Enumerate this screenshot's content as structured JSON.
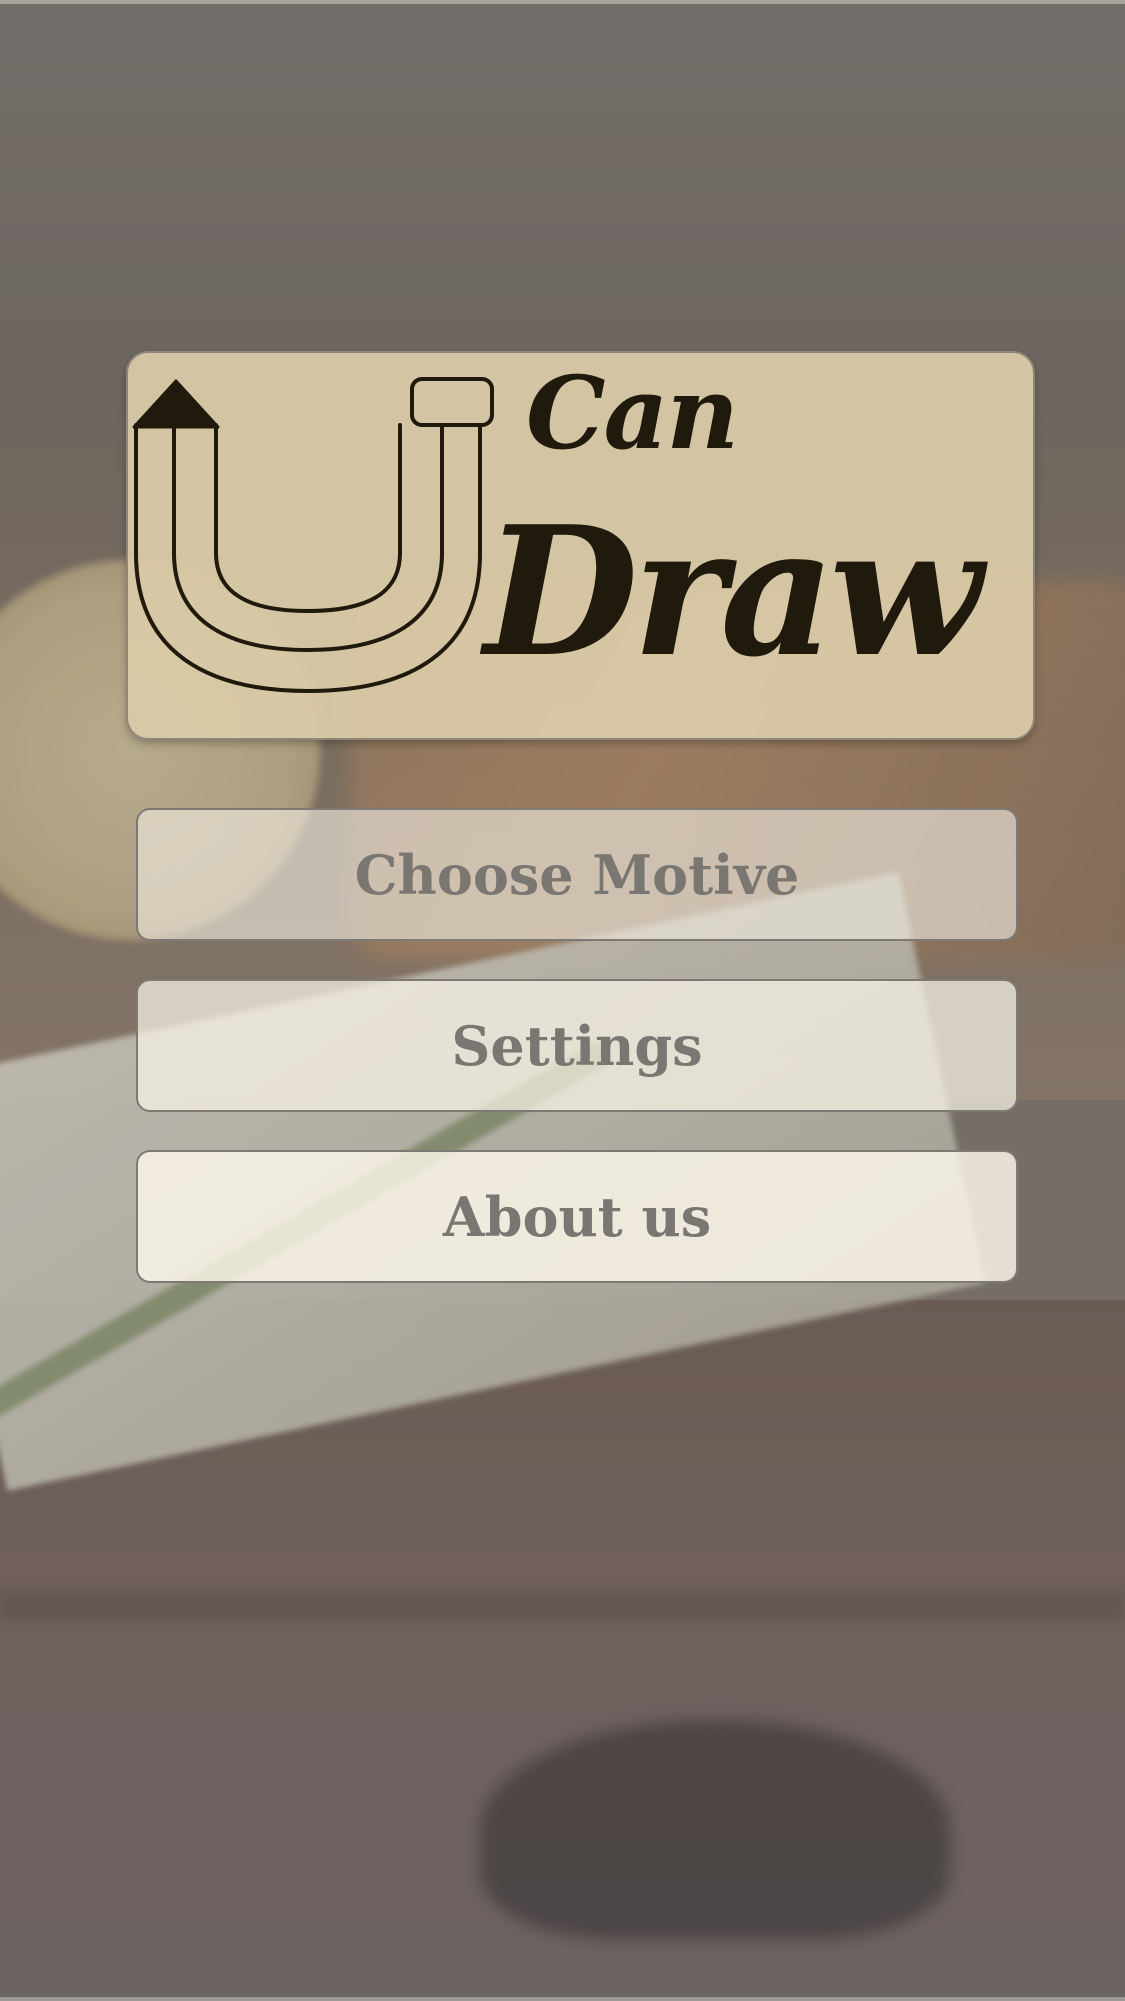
{
  "logo": {
    "line1": "Can",
    "line2": "Draw",
    "icon": "u-shaped-pencil-icon",
    "ink_color": "#1f1a0c",
    "card_color": "#dacba8"
  },
  "menu": {
    "items": [
      {
        "label": "Choose Motive"
      },
      {
        "label": "Settings"
      },
      {
        "label": "About us"
      }
    ],
    "text_color": "#7a7672"
  }
}
